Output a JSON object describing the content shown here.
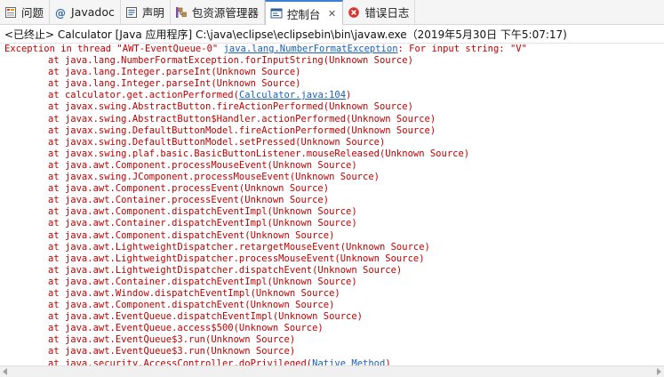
{
  "tabs": [
    {
      "label": "问题",
      "icon": "problems-icon",
      "active": false
    },
    {
      "label": "Javadoc",
      "icon": "javadoc-icon",
      "active": false
    },
    {
      "label": "声明",
      "icon": "declaration-icon",
      "active": false
    },
    {
      "label": "包资源管理器",
      "icon": "package-explorer-icon",
      "active": false
    },
    {
      "label": "控制台",
      "icon": "console-icon",
      "active": true,
      "close": "✕"
    },
    {
      "label": "错误日志",
      "icon": "error-log-icon",
      "active": false
    }
  ],
  "status": "<已终止> Calculator [Java 应用程序] C:\\java\\eclipse\\eclipsebin\\bin\\javaw.exe（2019年5月30日 下午5:07:17)",
  "console": {
    "first_line": {
      "prefix": "Exception in thread \"AWT-EventQueue-0\" ",
      "link": "java.lang.NumberFormatException",
      "suffix": ": For input string: \"V\""
    },
    "lines": [
      {
        "text": "at java.lang.NumberFormatException.forInputString(Unknown Source)"
      },
      {
        "text": "at java.lang.Integer.parseInt(Unknown Source)"
      },
      {
        "text": "at java.lang.Integer.parseInt(Unknown Source)"
      },
      {
        "text": "at calculator.get.actionPerformed(",
        "link": "Calculator.java:104",
        "after": ")"
      },
      {
        "text": "at javax.swing.AbstractButton.fireActionPerformed(Unknown Source)"
      },
      {
        "text": "at javax.swing.AbstractButton$Handler.actionPerformed(Unknown Source)"
      },
      {
        "text": "at javax.swing.DefaultButtonModel.fireActionPerformed(Unknown Source)"
      },
      {
        "text": "at javax.swing.DefaultButtonModel.setPressed(Unknown Source)"
      },
      {
        "text": "at javax.swing.plaf.basic.BasicButtonListener.mouseReleased(Unknown Source)"
      },
      {
        "text": "at java.awt.Component.processMouseEvent(Unknown Source)"
      },
      {
        "text": "at javax.swing.JComponent.processMouseEvent(Unknown Source)"
      },
      {
        "text": "at java.awt.Component.processEvent(Unknown Source)"
      },
      {
        "text": "at java.awt.Container.processEvent(Unknown Source)"
      },
      {
        "text": "at java.awt.Component.dispatchEventImpl(Unknown Source)"
      },
      {
        "text": "at java.awt.Container.dispatchEventImpl(Unknown Source)"
      },
      {
        "text": "at java.awt.Component.dispatchEvent(Unknown Source)"
      },
      {
        "text": "at java.awt.LightweightDispatcher.retargetMouseEvent(Unknown Source)"
      },
      {
        "text": "at java.awt.LightweightDispatcher.processMouseEvent(Unknown Source)"
      },
      {
        "text": "at java.awt.LightweightDispatcher.dispatchEvent(Unknown Source)"
      },
      {
        "text": "at java.awt.Container.dispatchEventImpl(Unknown Source)"
      },
      {
        "text": "at java.awt.Window.dispatchEventImpl(Unknown Source)"
      },
      {
        "text": "at java.awt.Component.dispatchEvent(Unknown Source)"
      },
      {
        "text": "at java.awt.EventQueue.dispatchEventImpl(Unknown Source)"
      },
      {
        "text": "at java.awt.EventQueue.access$500(Unknown Source)"
      },
      {
        "text": "at java.awt.EventQueue$3.run(Unknown Source)"
      },
      {
        "text": "at java.awt.EventQueue$3.run(Unknown Source)"
      },
      {
        "text": "at java.security.AccessController.doPrivileged(",
        "link_plain": "Native Method",
        "after": ")"
      }
    ]
  },
  "colors": {
    "error_text": "#c00000",
    "link": "#1a5fb4",
    "active_tab_accent": "#3b7fd5"
  }
}
